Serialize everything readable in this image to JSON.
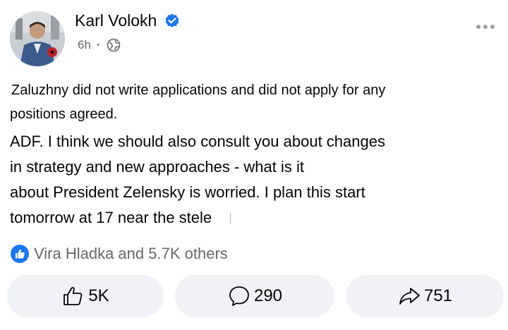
{
  "post": {
    "author": "Karl Volokh",
    "time": "6h",
    "separator": "·",
    "lines": [
      "Zaluzhny did not write applications and did not apply for any",
      "positions agreed.",
      "ADF. I think we should also consult you about changes",
      "in strategy and new approaches - what is it",
      "about President Zelensky is worried. I plan this start",
      "tomorrow at 17 near the stele"
    ]
  },
  "reactions": {
    "summary": "Vira Hladka and 5.7K others"
  },
  "actions": {
    "likes": "5K",
    "comments": "290",
    "shares": "751"
  },
  "colors": {
    "verified_blue": "#1877f2",
    "secondary_text": "#65676b",
    "pill_bg": "#f0f2f5"
  },
  "icons": [
    "verified-badge-icon",
    "globe-icon",
    "more-options-icon",
    "like-badge-icon",
    "thumbs-up-icon",
    "comment-icon",
    "share-arrow-icon"
  ]
}
